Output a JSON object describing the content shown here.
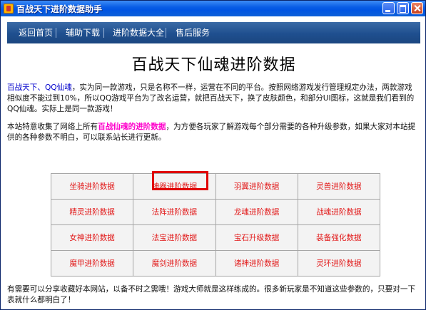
{
  "window": {
    "title": "百战天下进阶数据助手"
  },
  "nav": [
    "返回首页",
    "辅助下载",
    "进阶数据大全",
    "售后服务"
  ],
  "page_title": "百战天下仙魂进阶数据",
  "intro": {
    "link": "百战天下、QQ仙魂",
    "text": "，实为同一款游戏，只是名称不一样，运营在不同的平台。按照网络游戏发行管理规定办法，两款游戏相似度不能过到10%，所以QQ游戏平台为了改名运营，就把百战天下，换了皮肤颜色，和部分UI图标，这就是我们看到的QQ仙魂。实际上是同一款游戏！"
  },
  "collection": {
    "before": "本站特意收集了网络上所有",
    "highlight": "百战仙魂的进阶数据",
    "after": "，为方便各玩家了解游戏每个部分需要的各种升级参数，如果大家对本站提供的各种参数不明白，可以联系站长进行更新。"
  },
  "grid": [
    [
      "坐骑进阶数据",
      "神器进阶数据",
      "羽翼进阶数据",
      "灵兽进阶数据"
    ],
    [
      "精灵进阶数据",
      "法阵进阶数据",
      "龙魂进阶数据",
      "战魂进阶数据"
    ],
    [
      "女神进阶数据",
      "法宝进阶数据",
      "宝石升级数据",
      "装备强化数据"
    ],
    [
      "魔甲进阶数据",
      "魔剑进阶数据",
      "诸神进阶数据",
      "灵环进阶数据"
    ]
  ],
  "footer": "有需要可以分享收藏好本网站，以备不时之需哦！游戏大师就是这样练成的。很多新玩家是不知道这些参数的，只要对一下表就什么都明白了！",
  "colors": {
    "titlebar": "#0054e3",
    "nav": "#1f4f8f",
    "grid_text": "#e21b1b",
    "highlight_border": "#e00000",
    "link_blue": "#0000cc",
    "link_pink": "#ff00cc"
  }
}
